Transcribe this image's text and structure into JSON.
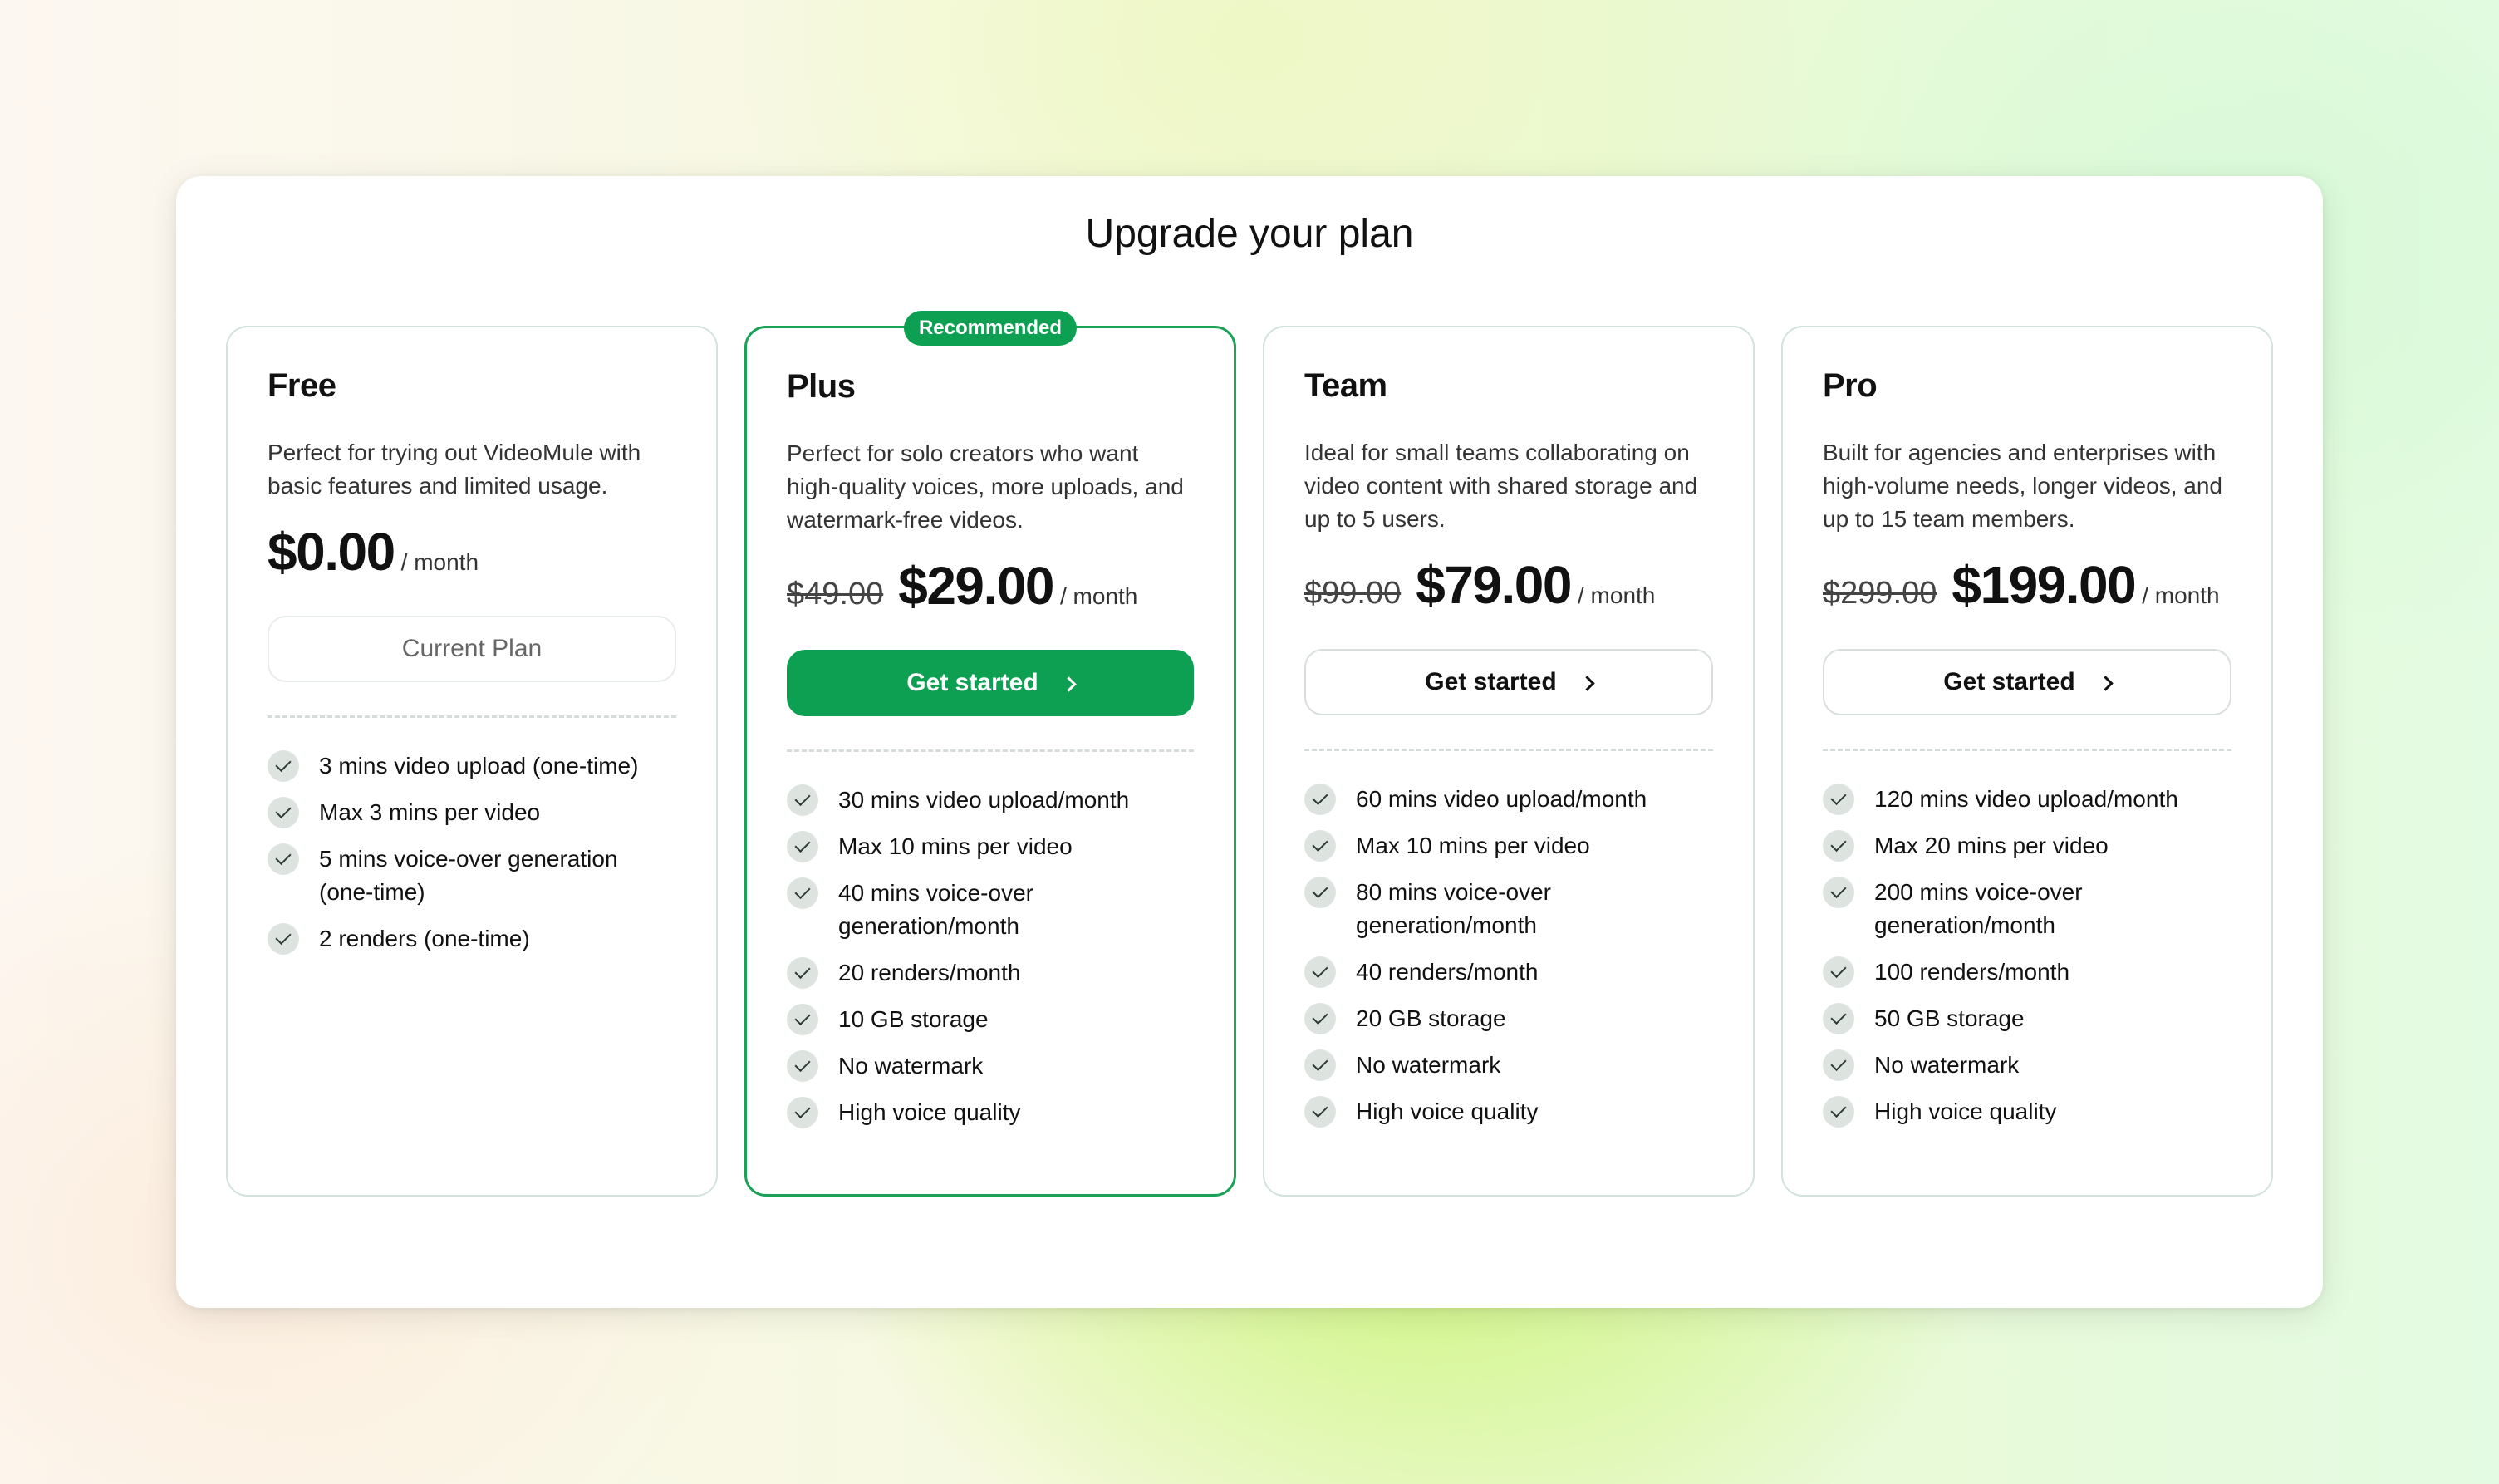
{
  "page": {
    "title": "Upgrade your plan"
  },
  "plans": [
    {
      "name": "Free",
      "description": "Perfect for trying out VideoMule with basic features and limited usage.",
      "old_price": "",
      "price": "$0.00",
      "period": "/ month",
      "cta_label": "Current Plan",
      "features": [
        "3 mins video upload (one-time)",
        "Max 3 mins per video",
        "5 mins voice-over generation (one-time)",
        "2 renders (one-time)"
      ]
    },
    {
      "name": "Plus",
      "badge": "Recommended",
      "description": "Perfect for solo creators who want high-quality voices, more uploads, and watermark-free videos.",
      "old_price": "$49.00",
      "price": "$29.00",
      "period": "/ month",
      "cta_label": "Get started",
      "features": [
        "30 mins video upload/month",
        "Max 10 mins per video",
        "40 mins voice-over generation/month",
        "20 renders/month",
        "10 GB storage",
        "No watermark",
        "High voice quality"
      ]
    },
    {
      "name": "Team",
      "description": "Ideal for small teams collaborating on video content with shared storage and up to 5 users.",
      "old_price": "$99.00",
      "price": "$79.00",
      "period": "/ month",
      "cta_label": "Get started",
      "features": [
        "60 mins video upload/month",
        "Max 10 mins per video",
        "80 mins voice-over generation/month",
        "40 renders/month",
        "20 GB storage",
        "No watermark",
        "High voice quality"
      ]
    },
    {
      "name": "Pro",
      "description": "Built for agencies and enterprises with high-volume needs, longer videos, and up to 15 team members.",
      "old_price": "$299.00",
      "price": "$199.00",
      "period": "/ month",
      "cta_label": "Get started",
      "features": [
        "120 mins video upload/month",
        "Max 20 mins per video",
        "200 mins voice-over generation/month",
        "100 renders/month",
        "50 GB storage",
        "No watermark",
        "High voice quality"
      ]
    }
  ],
  "colors": {
    "accent": "#0ea052",
    "recommended_border": "#1aa257",
    "check_bg": "#dde4e0"
  },
  "icons": {
    "feature": "check-icon",
    "cta": "chevron-right-icon"
  }
}
